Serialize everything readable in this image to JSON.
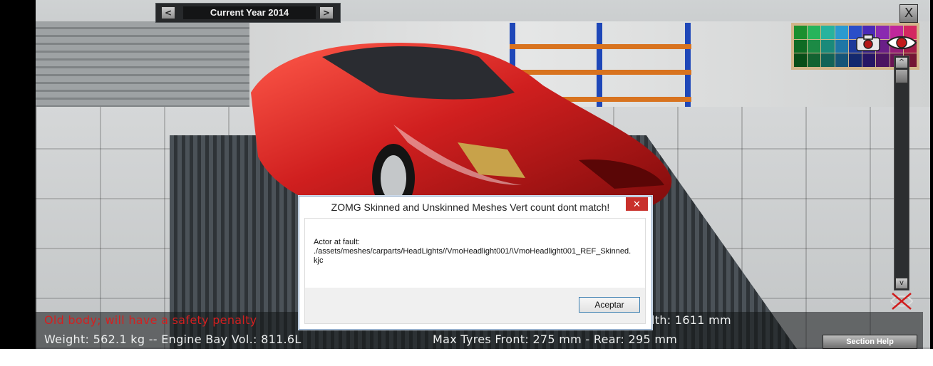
{
  "game": {
    "year_label": "Current Year 2014",
    "prev_year_glyph": "<",
    "next_year_glyph": ">",
    "close_glyph": "X",
    "icons": [
      "camera-icon",
      "eye-icon",
      "no-view-icon",
      "chevron-up-icon",
      "chevron-down-icon"
    ],
    "scroll_up_glyph": "^",
    "scroll_down_glyph": "v",
    "section_help_label": "Section Help",
    "info": {
      "penalty_text": "Old body; will have a safety penalty",
      "weight_text": "Weight: 562.1 kg -- Engine Bay Vol.: 811.6L",
      "width_text": "lth: 1611 mm",
      "tyres_text": "Max Tyres Front: 275 mm - Rear: 295 mm"
    },
    "colors": {
      "penalty": "#d42020",
      "car_paint": "#d01f1f",
      "shelf_beam": "#d8731f",
      "shelf_post": "#1e47b8"
    },
    "palette_colors": [
      "#1b8f2f",
      "#27b45b",
      "#27b39e",
      "#2b9ad0",
      "#2a4fc8",
      "#4a2ab8",
      "#8a2ab0",
      "#c0279b",
      "#d42860",
      "#0f6b24",
      "#1c8a45",
      "#1a8a7a",
      "#1e76a6",
      "#1d3a9a",
      "#36208e",
      "#6a1f88",
      "#951d77",
      "#a31d4a",
      "#094d18",
      "#136331",
      "#126357",
      "#155578",
      "#14296e",
      "#261665",
      "#4b1561",
      "#6a1455",
      "#741534"
    ]
  },
  "dialog": {
    "title": "ZOMG Skinned and Unskinned Meshes Vert count dont match!",
    "close_glyph": "✕",
    "message": "Actor at fault:\n./assets/meshes/carparts/HeadLights//VmoHeadlight001/\\VmoHeadlight001_REF_Skinned.kjc",
    "ok_label": "Aceptar"
  }
}
